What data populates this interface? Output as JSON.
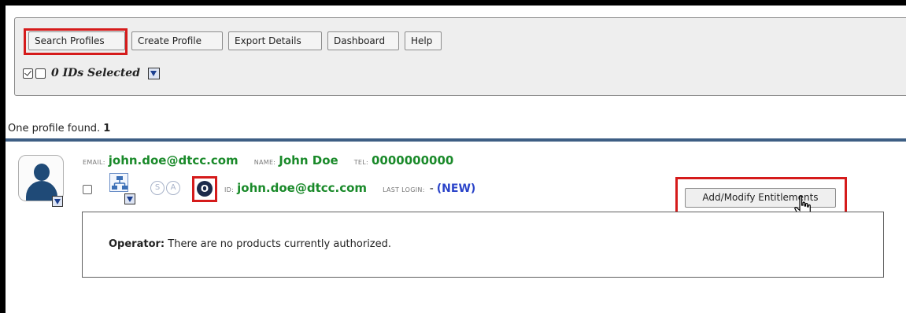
{
  "toolbar": {
    "buttons": [
      {
        "label": "Search Profiles"
      },
      {
        "label": "Create Profile"
      },
      {
        "label": "Export Details"
      },
      {
        "label": "Dashboard"
      },
      {
        "label": "Help"
      }
    ],
    "selection_text": "0 IDs Selected"
  },
  "results": {
    "found_text": "One profile found.",
    "count": "1"
  },
  "profile": {
    "email_label": "EMAIL:",
    "email": "john.doe@dtcc.com",
    "name_label": "NAME:",
    "name": "John Doe",
    "tel_label": "TEL:",
    "tel": "0000000000",
    "id_label": "ID:",
    "id": "john.doe@dtcc.com",
    "last_login_label": "LAST LOGIN:",
    "last_login_dash": "-",
    "last_login": "(NEW)",
    "role_badges": [
      "S",
      "A",
      "O"
    ],
    "add_button_label": "Add/Modify Entitlements",
    "operator_label": "Operator:",
    "operator_text": "There are no products currently authorized."
  },
  "colors": {
    "green_value": "#1a8a2a",
    "blue_new": "#2b44c9",
    "separator": "#3d5e84",
    "highlight_red": "#d51b1b"
  },
  "icons": [
    "check-all-icon",
    "uncheck-all-icon",
    "dropdown-icon",
    "user-avatar-icon",
    "org-tree-icon",
    "hand-cursor-icon"
  ]
}
